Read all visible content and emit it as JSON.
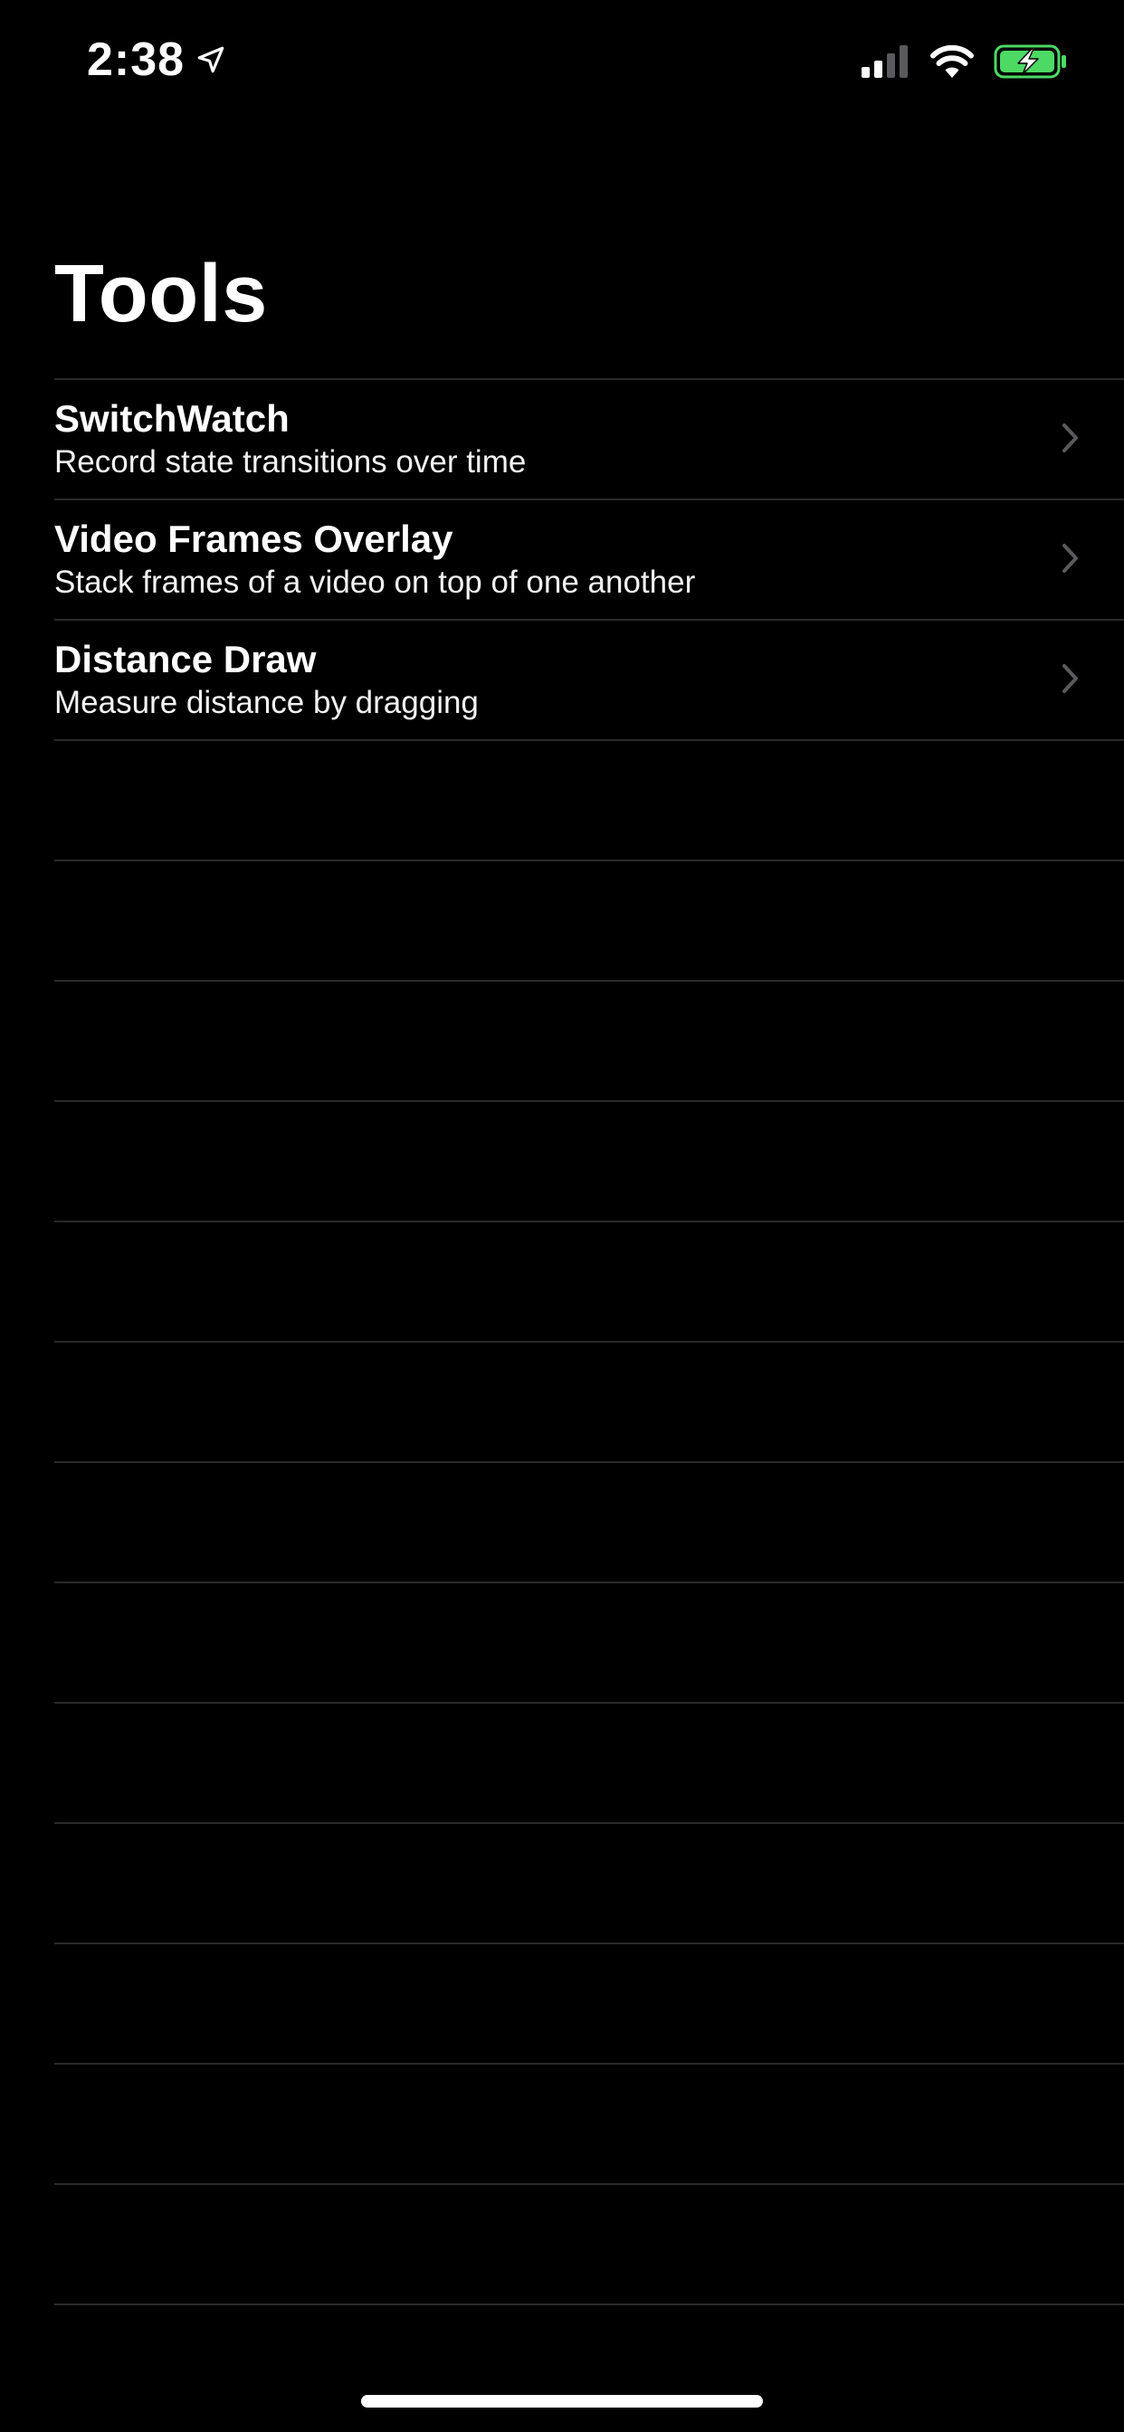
{
  "status_bar": {
    "time": "2:38",
    "icons": [
      "location-arrow-icon",
      "cellular-signal-icon",
      "wifi-icon",
      "battery-charging-icon"
    ],
    "battery_color": "#4cd964",
    "signal_bars_active": 2,
    "signal_bars_total": 4
  },
  "page": {
    "title": "Tools"
  },
  "list": {
    "items": [
      {
        "title": "SwitchWatch",
        "subtitle": "Record state transitions over time"
      },
      {
        "title": "Video Frames Overlay",
        "subtitle": "Stack frames of a video on top of one another"
      },
      {
        "title": "Distance Draw",
        "subtitle": "Measure distance by dragging"
      }
    ],
    "empty_rows": 14,
    "separator_color": "#2a2a2c"
  },
  "colors": {
    "background": "#000000",
    "text": "#ffffff",
    "chevron": "#5a5a5e"
  }
}
